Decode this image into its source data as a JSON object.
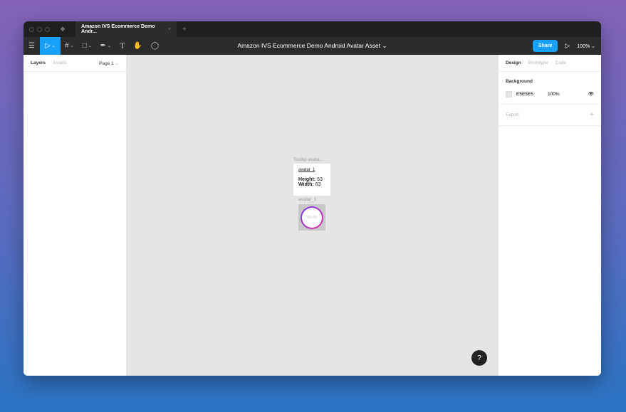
{
  "tab": {
    "title": "Amazon IVS Ecommerce Demo Andr...",
    "close": "×",
    "new": "+"
  },
  "toolbar": {
    "file_title": "Amazon IVS Ecommerce Demo Android Avatar Asset",
    "title_chevron": "⌄",
    "share": "Share",
    "play": "▷",
    "zoom": "100%"
  },
  "left": {
    "tabs": [
      "Layers",
      "Assets"
    ],
    "page": "Page 1"
  },
  "right": {
    "tabs": [
      "Design",
      "Prototype",
      "Code"
    ],
    "background_label": "Background",
    "bg_hex": "E5E5E5",
    "bg_opacity": "100%",
    "export_label": "Export",
    "add": "+"
  },
  "canvas": {
    "tooltip_frame_label": "Tooltip avata...",
    "tooltip_name": "avatar_1",
    "height_label": "Height:",
    "height_value": "63",
    "width_label": "Width:",
    "width_value": "63",
    "avatar_frame_label": "avatar_1",
    "avatar_size": "49×49"
  },
  "help": "?",
  "colors": {
    "accent": "#18a0fb",
    "canvas": "#E5E5E5"
  }
}
